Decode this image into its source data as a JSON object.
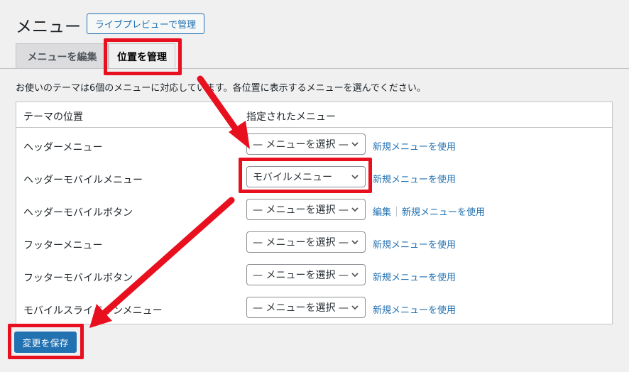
{
  "page_title": "メニュー",
  "live_preview_button": "ライブプレビューで管理",
  "tabs": [
    {
      "label": "メニューを編集",
      "active": false
    },
    {
      "label": "位置を管理",
      "active": true
    }
  ],
  "description": "お使いのテーマは6個のメニューに対応しています。各位置に表示するメニューを選んでください。",
  "table": {
    "headers": [
      "テーマの位置",
      "指定されたメニュー"
    ],
    "rows": [
      {
        "location": "ヘッダーメニュー",
        "selected": "— メニューを選択 —",
        "links": [
          "新規メニューを使用"
        ]
      },
      {
        "location": "ヘッダーモバイルメニュー",
        "selected": "モバイルメニュー",
        "links": [
          "新規メニューを使用"
        ]
      },
      {
        "location": "ヘッダーモバイルボタン",
        "selected": "— メニューを選択 —",
        "links": [
          "編集",
          "新規メニューを使用"
        ]
      },
      {
        "location": "フッターメニュー",
        "selected": "— メニューを選択 —",
        "links": [
          "新規メニューを使用"
        ]
      },
      {
        "location": "フッターモバイルボタン",
        "selected": "— メニューを選択 —",
        "links": [
          "新規メニューを使用"
        ]
      },
      {
        "location": "モバイルスライドインメニュー",
        "selected": "— メニューを選択 —",
        "links": [
          "新規メニューを使用"
        ]
      }
    ]
  },
  "save_button": "変更を保存",
  "colors": {
    "accent": "#2271b1",
    "highlight": "#e8101e",
    "background": "#f0f0f1"
  }
}
